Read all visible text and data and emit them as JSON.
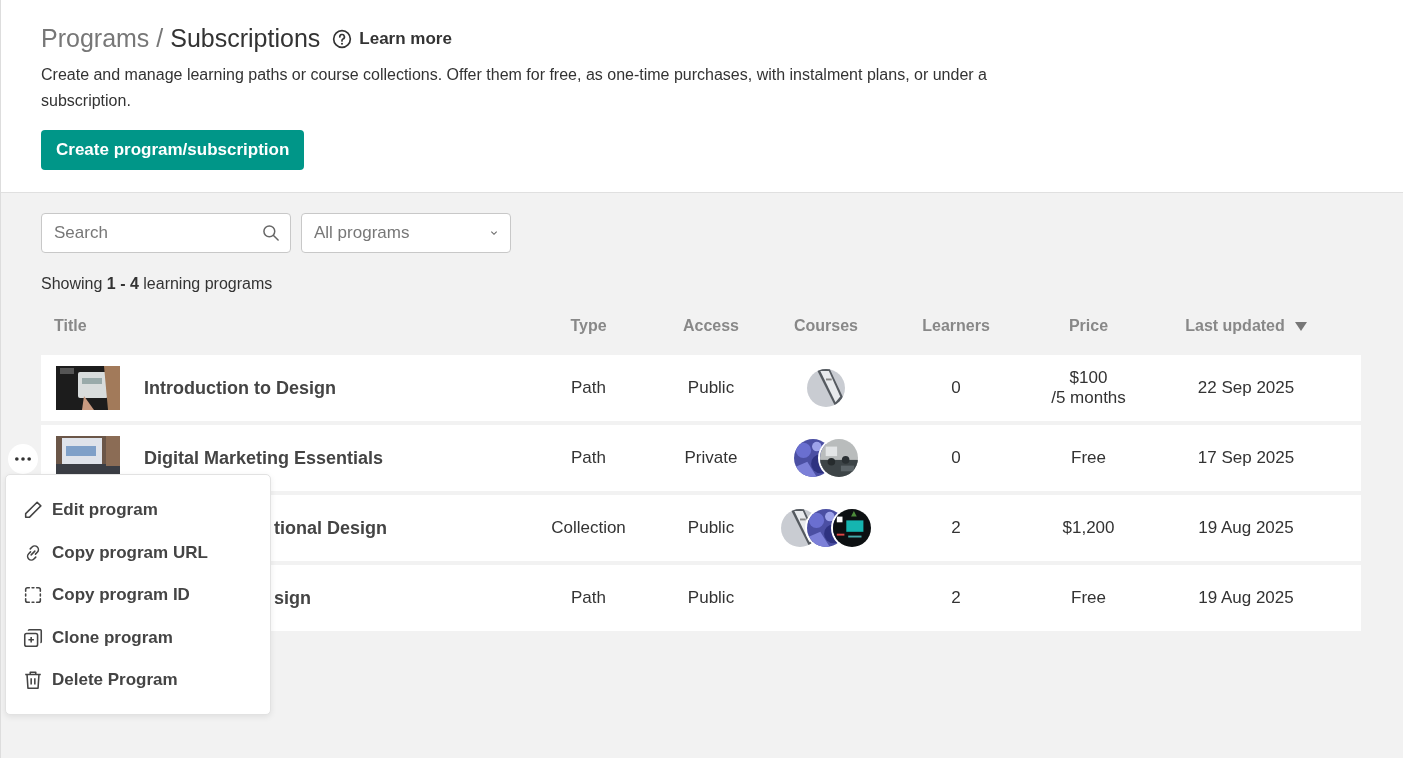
{
  "header": {
    "breadcrumb_parent": "Programs",
    "separator": "/",
    "title": "Subscriptions",
    "learn_more": "Learn more",
    "description": "Create and manage learning paths or course collections. Offer them for free, as one-time purchases, with instalment plans, or under a subscription.",
    "create_button": "Create program/subscription"
  },
  "filters": {
    "search": {
      "placeholder": "Search"
    },
    "program_filter": {
      "value": "All programs"
    }
  },
  "summary": "Showing **1 - 4** learning programs",
  "table": {
    "columns": [
      {
        "label": "Title"
      },
      {
        "label": "Type"
      },
      {
        "label": "Access"
      },
      {
        "label": "Courses"
      },
      {
        "label": "Learners"
      },
      {
        "label": "Price"
      },
      {
        "label": "Last updated",
        "sorted_descending": true
      }
    ],
    "rows": [
      {
        "title": "Introduction to Design",
        "thumbnail": true,
        "type": "Path",
        "access": "Public",
        "learners": "0",
        "price": "$100",
        "price_period": "/5 months",
        "last_updated": "22 Sep 2025"
      },
      {
        "title": "Digital Marketing Essentials",
        "thumbnail": true,
        "type": "Path",
        "access": "Private",
        "learners": "0",
        "price": "Free",
        "last_updated": "17 Sep 2025",
        "menu_open": true
      },
      {
        "title": "tional Design",
        "type": "Collection",
        "access": "Public",
        "learners": "2",
        "price": "$1,200",
        "last_updated": "19 Aug 2025"
      },
      {
        "title": "sign",
        "type": "Path",
        "access": "Public",
        "learners": "2",
        "price": "Free",
        "last_updated": "19 Aug 2025"
      }
    ]
  },
  "context_menu": {
    "items": [
      {
        "label": "Edit program",
        "kind": "edit"
      },
      {
        "label": "Copy program URL",
        "kind": "link"
      },
      {
        "label": "Copy program ID",
        "kind": "id"
      },
      {
        "label": "Clone program",
        "kind": "clone"
      },
      {
        "label": "Delete Program",
        "kind": "delete"
      }
    ]
  }
}
